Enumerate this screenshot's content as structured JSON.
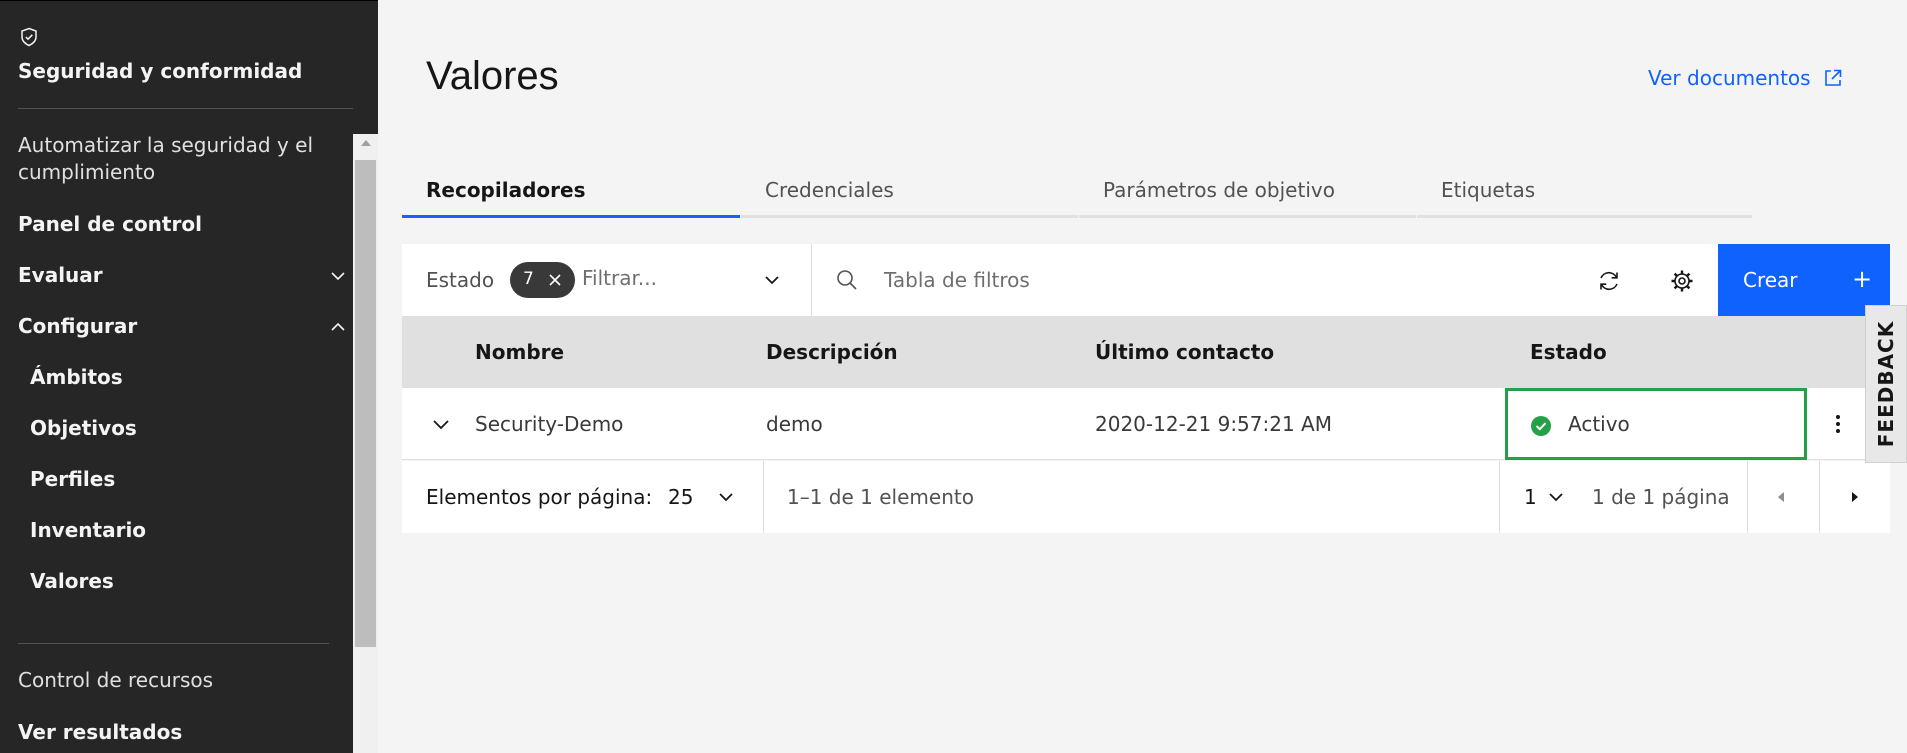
{
  "sidebar": {
    "title": "Seguridad y conformidad",
    "items": [
      {
        "label": "Automatizar la seguridad y el cumplimiento"
      },
      {
        "label": "Panel de control"
      },
      {
        "label": "Evaluar"
      },
      {
        "label": "Configurar"
      },
      {
        "label": "Ámbitos"
      },
      {
        "label": "Objetivos"
      },
      {
        "label": "Perfiles"
      },
      {
        "label": "Inventario"
      },
      {
        "label": "Valores"
      },
      {
        "label": "Control de recursos"
      },
      {
        "label": "Ver resultados"
      }
    ]
  },
  "header": {
    "title": "Valores",
    "docs_link": "Ver documentos"
  },
  "tabs": [
    {
      "label": "Recopiladores",
      "active": true
    },
    {
      "label": "Credenciales",
      "active": false
    },
    {
      "label": "Parámetros de objetivo",
      "active": false
    },
    {
      "label": "Etiquetas",
      "active": false
    }
  ],
  "toolbar": {
    "filter_label": "Estado",
    "filter_count": "7",
    "filter_placeholder": "Filtrar...",
    "search_placeholder": "Tabla de filtros",
    "create_label": "Crear",
    "create_icon": "+"
  },
  "table": {
    "columns": [
      "Nombre",
      "Descripción",
      "Último contacto",
      "Estado"
    ],
    "rows": [
      {
        "name": "Security-Demo",
        "description": "demo",
        "last_contact": "2020-12-21 9:57:21 AM",
        "status": "Activo"
      }
    ]
  },
  "pagination": {
    "per_page_label": "Elementos por página:",
    "per_page_value": "25",
    "range_text": "1–1 de 1 elemento",
    "page_value": "1",
    "pages_text": "1 de 1 página"
  },
  "feedback": {
    "label": "FEEDBACK"
  },
  "colors": {
    "sidebar_bg": "#262626",
    "accent": "#0f62fe",
    "status_ok": "#24a148",
    "highlight_border": "#24a148"
  }
}
